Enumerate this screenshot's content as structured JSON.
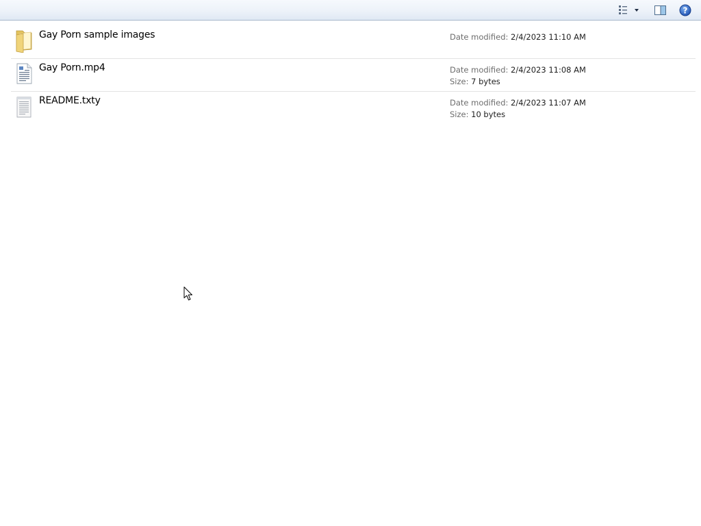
{
  "toolbar": {
    "views_icon": "views-icon",
    "preview_icon": "preview-pane-icon",
    "help_icon": "help-icon"
  },
  "files": [
    {
      "icon": "folder-icon",
      "name": "Gay Porn sample images",
      "date_label": "Date modified:",
      "date": "2/4/2023 11:10 AM"
    },
    {
      "icon": "document-icon",
      "name": "Gay Porn.mp4",
      "date_label": "Date modified:",
      "date": "2/4/2023 11:08 AM",
      "size_label": "Size:",
      "size": "7 bytes"
    },
    {
      "icon": "text-file-icon",
      "name": "README.txty",
      "date_label": "Date modified:",
      "date": "2/4/2023 11:07 AM",
      "size_label": "Size:",
      "size": "10 bytes"
    }
  ],
  "colors": {
    "toolbar_bg": "#edf2f9",
    "divider": "#e3e3e3",
    "meta_label": "#6d6d6d",
    "meta_value": "#1e1e1e"
  }
}
